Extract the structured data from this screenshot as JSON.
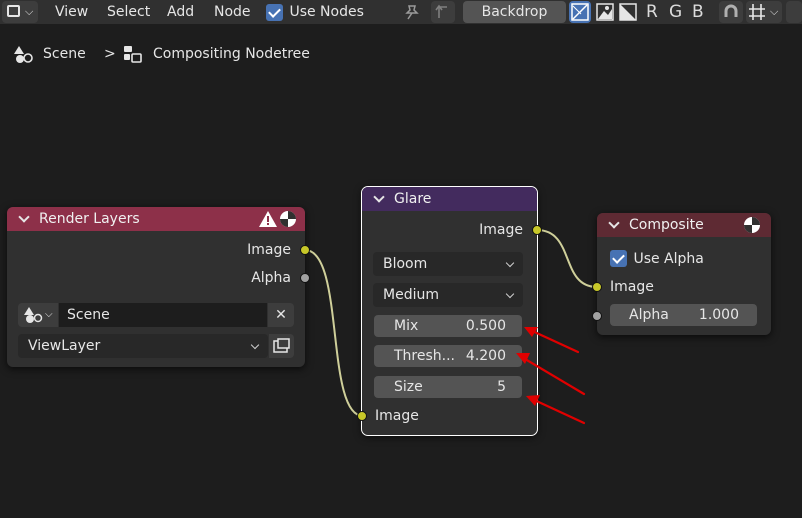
{
  "header": {
    "menu": [
      "View",
      "Select",
      "Add",
      "Node"
    ],
    "use_nodes_label": "Use Nodes",
    "backdrop_label": "Backdrop",
    "channels": [
      "R",
      "G",
      "B"
    ]
  },
  "breadcrumb": {
    "scene": "Scene",
    "separator": ">",
    "nodetree": "Compositing Nodetree"
  },
  "render_layers": {
    "title": "Render Layers",
    "outputs": [
      "Image",
      "Alpha"
    ],
    "scene_value": "Scene",
    "view_layer_value": "ViewLayer",
    "header_color": "#8d3049"
  },
  "glare": {
    "title": "Glare",
    "output": "Image",
    "glare_type": "Bloom",
    "quality": "Medium",
    "fields": [
      {
        "label": "Mix",
        "value": "0.500"
      },
      {
        "label": "Thresh...",
        "value": "4.200"
      },
      {
        "label": "Size",
        "value": "5"
      }
    ],
    "input": "Image",
    "header_color": "#432b5e"
  },
  "composite": {
    "title": "Composite",
    "use_alpha_label": "Use Alpha",
    "input": "Image",
    "alpha_label": "Alpha",
    "alpha_value": "1.000",
    "header_color": "#5e2a33"
  },
  "colors": {
    "link": "#cfcf9a",
    "socket_color": "#c7c729",
    "socket_gray": "#a1a1a1",
    "annotation_arrows": "#e00000",
    "accent": "#4772b3"
  }
}
